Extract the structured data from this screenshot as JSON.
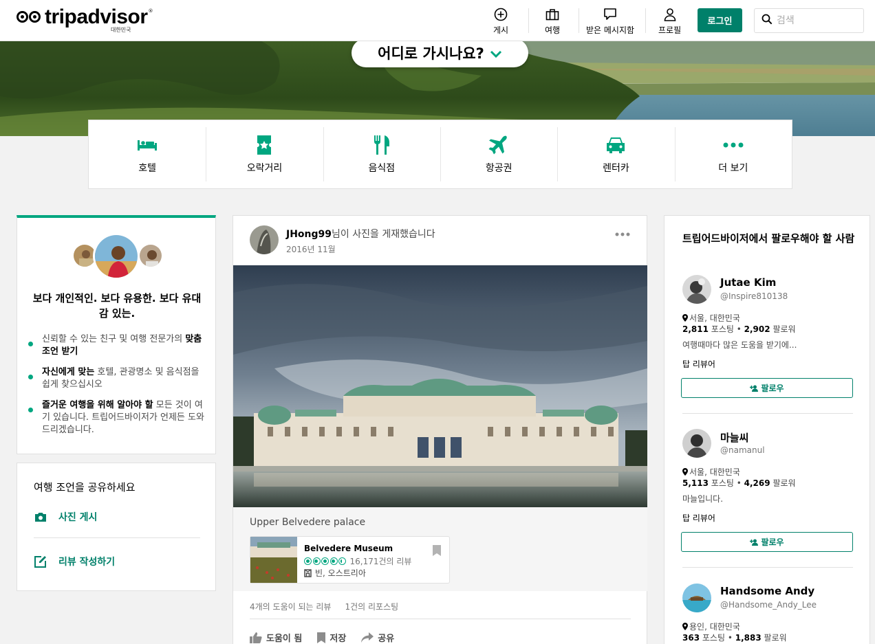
{
  "header": {
    "logo_text": "tripadvisor",
    "logo_region": "대한민국",
    "nav": [
      {
        "label": "게시",
        "icon": "plus-circle-icon"
      },
      {
        "label": "여행",
        "icon": "suitcase-icon"
      },
      {
        "label": "받은 메시지함",
        "icon": "message-icon"
      },
      {
        "label": "프로필",
        "icon": "profile-icon"
      }
    ],
    "login_label": "로그인",
    "search_placeholder": "검색"
  },
  "hero": {
    "where_label": "어디로 가시나요?"
  },
  "categories": [
    {
      "label": "호텔",
      "icon": "bed-icon"
    },
    {
      "label": "오락거리",
      "icon": "ticket-icon"
    },
    {
      "label": "음식점",
      "icon": "fork-knife-icon"
    },
    {
      "label": "항공권",
      "icon": "plane-icon"
    },
    {
      "label": "렌터카",
      "icon": "car-icon"
    },
    {
      "label": "더 보기",
      "icon": "more-icon"
    }
  ],
  "intro": {
    "title": "보다 개인적인. 보다 유용한. 보다 유대감 있는.",
    "bullets": [
      {
        "pre": "신뢰할 수 있는 친구 및 여행 전문가의 ",
        "bold": "맞춤 조언 받기",
        "post": ""
      },
      {
        "pre": "",
        "bold": "자신에게 맞는",
        "post": " 호텔, 관광명소 및 음식점을 쉽게 찾으십시오"
      },
      {
        "pre": "",
        "bold": "즐거운 여행을 위해 알아야 할",
        "post": " 모든 것이 여기 있습니다. 트립어드바이저가 언제든 도와드리겠습니다."
      }
    ]
  },
  "share": {
    "title": "여행 조언을 공유하세요",
    "photo_label": "사진 게시",
    "review_label": "리뷰 작성하기"
  },
  "post": {
    "user": "JHong99",
    "action_text": "님이 사진을 게재했습니다",
    "date": "2016년 11월",
    "caption": "Upper Belvedere palace",
    "place": {
      "name": "Belvedere Museum",
      "rating": 4.5,
      "reviews": "16,171건의 리뷰",
      "location": "빈, 오스트리아"
    },
    "stats": [
      "4개의 도움이 되는 리뷰",
      "1건의 리포스팅"
    ],
    "actions": {
      "helpful": "도움이 됨",
      "save": "저장",
      "share": "공유"
    }
  },
  "follow": {
    "title": "트립어드바이저에서 팔로우해야 할 사람",
    "follow_label": "팔로우",
    "people": [
      {
        "name": "Jutae Kim",
        "handle": "@Inspire810138",
        "location": "서울, 대한민국",
        "posts": "2,811",
        "followers": "2,902",
        "posts_label": "포스팅",
        "followers_label": "팔로워",
        "bio": "여행때마다 많은 도움을 받기에...",
        "badge": "탑 리뷰어"
      },
      {
        "name": "마늘씨",
        "handle": "@namanul",
        "location": "서울, 대한민국",
        "posts": "5,113",
        "followers": "4,269",
        "posts_label": "포스팅",
        "followers_label": "팔로워",
        "bio": "마늘입니다.",
        "badge": "탑 리뷰어"
      },
      {
        "name": "Handsome Andy",
        "handle": "@Handsome_Andy_Lee",
        "location": "용인, 대한민국",
        "posts": "363",
        "followers": "1,883",
        "posts_label": "포스팅",
        "followers_label": "팔로워",
        "bio": "",
        "badge": ""
      }
    ]
  },
  "colors": {
    "brand": "#00a680",
    "brand_dark": "#00806a"
  }
}
